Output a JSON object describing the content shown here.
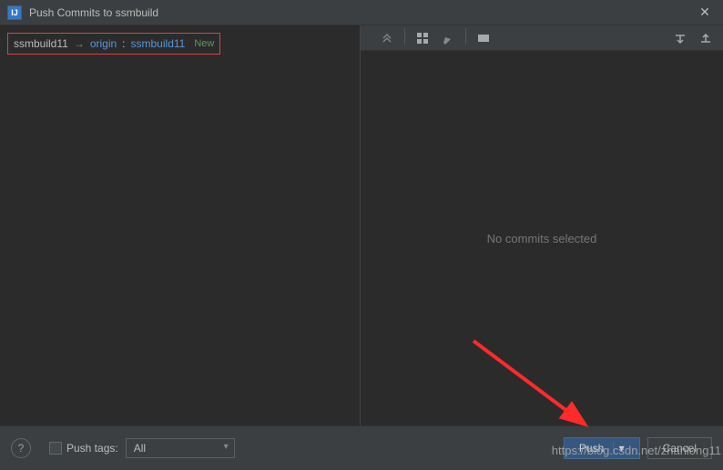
{
  "title": "Push Commits to ssmbuild",
  "branch": {
    "local": "ssmbuild11",
    "arrow": "→",
    "origin": "origin",
    "colon": ":",
    "remote": "ssmbuild11",
    "new_label": "New"
  },
  "right": {
    "empty_message": "No commits selected"
  },
  "bottom": {
    "push_tags_label": "Push tags:",
    "push_tags_value": "All",
    "push_button": "Push",
    "cancel_button": "Cancel",
    "help": "?"
  },
  "watermark": "https://blog.csdn.net/zhanlong11"
}
